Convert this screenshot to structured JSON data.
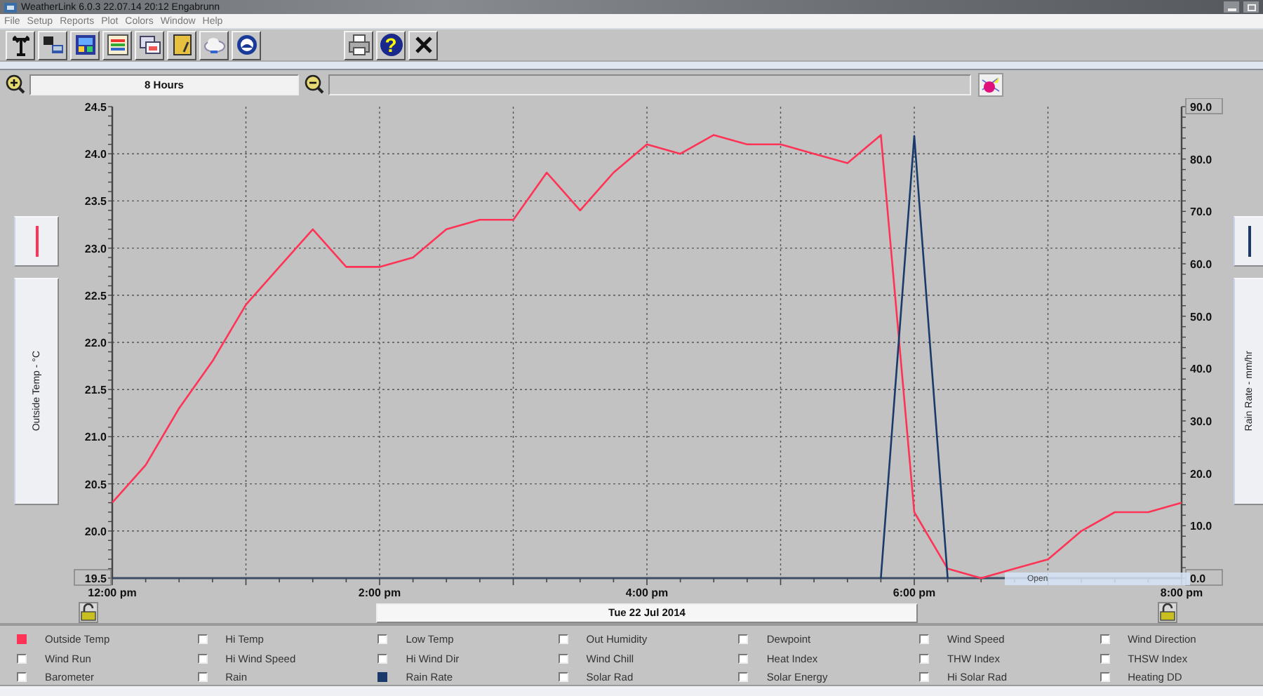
{
  "window": {
    "title": "WeatherLink 6.0.3  22.07.14  20:12  Engabrunn"
  },
  "menu": [
    "File",
    "Setup",
    "Reports",
    "Plot",
    "Colors",
    "Window",
    "Help"
  ],
  "toolbar": {
    "help_label": "?"
  },
  "range": {
    "value": "8 Hours"
  },
  "plot": {
    "overlay": "Open",
    "chart_data": {
      "type": "line",
      "xlabel": "Tue 22 Jul 2014",
      "ylabel": "Outside Temp - °C",
      "y2label": "Rain Rate - mm/hr",
      "categories": [
        "12:00 pm",
        null,
        null,
        null,
        null,
        null,
        null,
        null,
        "2:00 pm",
        null,
        null,
        null,
        null,
        null,
        null,
        null,
        "4:00 pm",
        null,
        null,
        null,
        null,
        null,
        null,
        null,
        "6:00 pm",
        null,
        null,
        null,
        null,
        null,
        null,
        null,
        "8:00 pm"
      ],
      "ylim": [
        19.5,
        24.5
      ],
      "y2lim": [
        0,
        90
      ],
      "grid": true,
      "yticks": [
        {
          "value": 19.5,
          "label": "19.5"
        },
        {
          "value": 20,
          "label": "20.0"
        },
        {
          "value": 20.5,
          "label": "20.5"
        },
        {
          "value": 21,
          "label": "21.0"
        },
        {
          "value": 21.5,
          "label": "21.5"
        },
        {
          "value": 22,
          "label": "22.0"
        },
        {
          "value": 22.5,
          "label": "22.5"
        },
        {
          "value": 23,
          "label": "23.0"
        },
        {
          "value": 23.5,
          "label": "23.5"
        },
        {
          "value": 24,
          "label": "24.0"
        },
        {
          "value": 24.5,
          "label": "24.5"
        }
      ],
      "y2ticks": [
        {
          "value": 0,
          "label": "0.0"
        },
        {
          "value": 10,
          "label": "10.0"
        },
        {
          "value": 20,
          "label": "20.0"
        },
        {
          "value": 30,
          "label": "30.0"
        },
        {
          "value": 40,
          "label": "40.0"
        },
        {
          "value": 50,
          "label": "50.0"
        },
        {
          "value": 60,
          "label": "60.0"
        },
        {
          "value": 70,
          "label": "70.0"
        },
        {
          "value": 80,
          "label": "80.0"
        },
        {
          "value": 90,
          "label": "90.0"
        }
      ],
      "series": [
        {
          "name": "Outside Temp",
          "color": "#ff3355",
          "values": [
            20.3,
            20.7,
            21.3,
            21.8,
            22.4,
            22.8,
            23.2,
            22.8,
            22.8,
            22.9,
            23.2,
            23.3,
            23.3,
            23.8,
            23.4,
            23.8,
            24.1,
            24.0,
            24.2,
            24.1,
            24.1,
            24.0,
            23.9,
            24.2,
            20.2,
            19.6,
            19.5,
            19.6,
            19.7,
            20.0,
            20.2,
            20.2,
            20.3
          ]
        },
        {
          "name": "Rain Rate",
          "color": "#1a3a6a",
          "axis": "y2",
          "values": [
            null,
            null,
            null,
            null,
            null,
            null,
            null,
            null,
            null,
            null,
            null,
            null,
            null,
            null,
            null,
            null,
            null,
            null,
            null,
            null,
            null,
            null,
            null,
            0,
            84.4,
            0,
            null,
            null,
            null,
            null,
            null,
            null,
            null
          ]
        }
      ]
    }
  },
  "legend": [
    {
      "kind": "series",
      "checked": true
    },
    {
      "label": "Hi Temp",
      "checked": false
    },
    {
      "label": "Low Temp",
      "checked": false
    },
    {
      "label": "Out Humidity",
      "checked": false
    },
    {
      "label": "Dewpoint",
      "checked": false
    },
    {
      "label": "Wind Speed",
      "checked": false
    },
    {
      "label": "Wind Direction",
      "checked": false
    },
    {
      "label": "Wind Run",
      "checked": false
    },
    {
      "label": "Hi Wind Speed",
      "checked": false
    },
    {
      "label": "Hi Wind Dir",
      "checked": false
    },
    {
      "label": "Wind Chill",
      "checked": false
    },
    {
      "label": "Heat Index",
      "checked": false
    },
    {
      "label": "THW Index",
      "checked": false
    },
    {
      "label": "THSW Index",
      "checked": false
    },
    {
      "label": "Barometer",
      "checked": false
    },
    {
      "label": "Rain",
      "checked": false
    },
    {
      "kind": "series",
      "checked": true
    },
    {
      "label": "Solar Rad",
      "checked": false
    },
    {
      "label": "Solar Energy",
      "checked": false
    },
    {
      "label": "Hi Solar Rad",
      "checked": false
    },
    {
      "label": "Heating DD",
      "checked": false
    }
  ]
}
